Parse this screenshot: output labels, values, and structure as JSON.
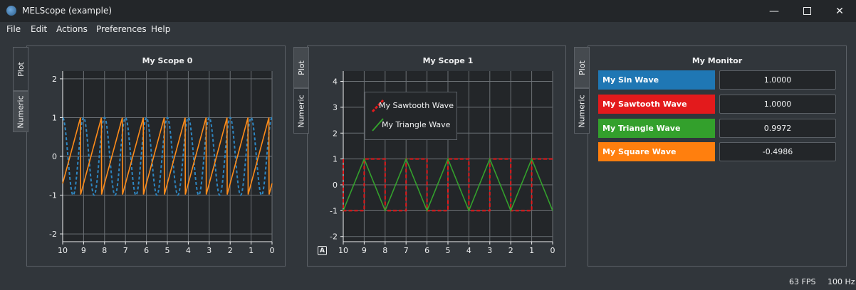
{
  "window": {
    "title": "MELScope (example)"
  },
  "menu": [
    "File",
    "Edit",
    "Actions",
    "Preferences",
    "Help"
  ],
  "tabs": {
    "plot": "Plot",
    "numeric": "Numeric"
  },
  "scope0": {
    "title": "My Scope 0",
    "chart_data": {
      "type": "line",
      "title": "My Scope 0",
      "xlim": [
        10,
        0
      ],
      "ylim": [
        -2.2,
        2.2
      ],
      "x_ticks": [
        "10",
        "9",
        "8",
        "7",
        "6",
        "5",
        "4",
        "3",
        "2",
        "1",
        "0"
      ],
      "y_ticks": [
        "2",
        "1",
        "0",
        "-1",
        "-2"
      ],
      "grid": true,
      "series": [
        {
          "kind": "sin",
          "color": "#2e86c1",
          "style": "dashed",
          "period": 1.0,
          "amplitude": 1,
          "phase_at_0": 1.0
        },
        {
          "kind": "sawtooth",
          "color": "#ff8c1a",
          "style": "solid",
          "period": 1.0,
          "amplitude": 1,
          "reset_at": 0.15
        }
      ]
    }
  },
  "scope1": {
    "title": "My Scope 1",
    "auto_label": "A",
    "legend": [
      "My Sawtooth Wave",
      "My Triangle Wave"
    ],
    "chart_data": {
      "type": "line",
      "title": "My Scope 1",
      "xlim": [
        10,
        0
      ],
      "ylim": [
        -2.2,
        4.4
      ],
      "x_ticks": [
        "10",
        "9",
        "8",
        "7",
        "6",
        "5",
        "4",
        "3",
        "2",
        "1",
        "0"
      ],
      "y_ticks": [
        "4",
        "3",
        "2",
        "1",
        "0",
        "-1",
        "-2"
      ],
      "grid": true,
      "series": [
        {
          "name": "My Sawtooth Wave",
          "kind": "square",
          "color": "#e31a1c",
          "style": "dashed",
          "period": 2.0,
          "amplitude": 1
        },
        {
          "name": "My Triangle Wave",
          "kind": "triangle",
          "color": "#33a02c",
          "style": "solid",
          "period": 2.0,
          "amplitude": 1
        }
      ]
    }
  },
  "monitor": {
    "title": "My Monitor",
    "rows": [
      {
        "label": "My Sin Wave",
        "value": "1.0000",
        "color": "#1f77b4"
      },
      {
        "label": "My Sawtooth Wave",
        "value": "1.0000",
        "color": "#e31a1c"
      },
      {
        "label": "My Triangle Wave",
        "value": "0.9972",
        "color": "#33a02c"
      },
      {
        "label": "My Square Wave",
        "value": "-0.4986",
        "color": "#ff7f0e"
      }
    ]
  },
  "status": {
    "fps": "63 FPS",
    "rate": "100 Hz"
  }
}
